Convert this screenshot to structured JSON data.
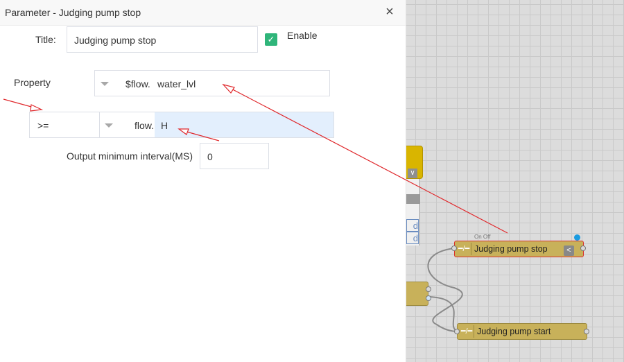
{
  "dialog": {
    "title": "Parameter - Judging pump stop",
    "close_icon": "×",
    "title_label": "Title:",
    "title_value": "Judging pump stop",
    "enable_checked": true,
    "enable_label": "Enable",
    "property_label": "Property",
    "property_prefix": "$flow.",
    "property_value": "water_lvl",
    "operator": ">=",
    "compare_prefix": "flow.",
    "compare_value": "H",
    "interval_label": "Output minimum interval(MS)",
    "interval_value": "0"
  },
  "canvas": {
    "partial_table_cells": [
      "d",
      "d"
    ],
    "nodes": [
      {
        "label": "Judging pump stop",
        "top_label": "On Off",
        "selected": true
      },
      {
        "label": "Judging pump start",
        "selected": false
      }
    ]
  },
  "colors": {
    "node_fill": "#c8b15a",
    "node_selected_border": "#d9302c",
    "checkbox": "#2fb57a",
    "annotation_arrow": "#e0282c",
    "highlight_field": "#e3effd"
  }
}
